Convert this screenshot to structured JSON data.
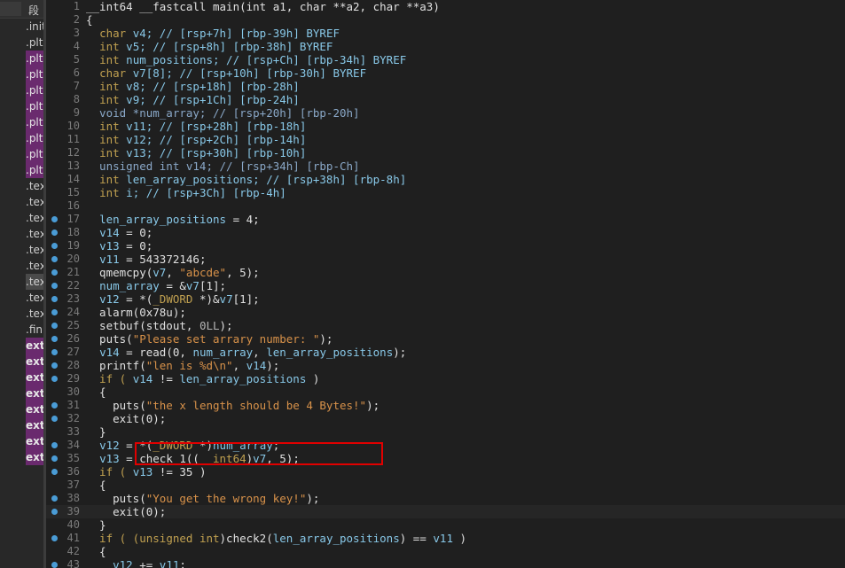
{
  "segments": {
    "header": "段",
    "rows": [
      {
        "label": ".init",
        "style": "plain"
      },
      {
        "label": ".plt",
        "style": "plain"
      },
      {
        "label": ".plt",
        "style": "purple"
      },
      {
        "label": ".plt",
        "style": "purple"
      },
      {
        "label": ".plt",
        "style": "purple"
      },
      {
        "label": ".plt",
        "style": "purple"
      },
      {
        "label": ".plt",
        "style": "purple"
      },
      {
        "label": ".plt",
        "style": "purple"
      },
      {
        "label": ".plt",
        "style": "purple"
      },
      {
        "label": ".plt",
        "style": "purple"
      },
      {
        "label": ".text",
        "style": "plain"
      },
      {
        "label": ".text",
        "style": "plain"
      },
      {
        "label": ".text",
        "style": "plain"
      },
      {
        "label": ".text",
        "style": "plain"
      },
      {
        "label": ".text",
        "style": "plain"
      },
      {
        "label": ".text",
        "style": "plain"
      },
      {
        "label": ".text",
        "style": "selected"
      },
      {
        "label": ".text",
        "style": "plain"
      },
      {
        "label": ".text",
        "style": "plain"
      },
      {
        "label": ".fini",
        "style": "plain"
      },
      {
        "label": "extern",
        "style": "ext"
      },
      {
        "label": "extern",
        "style": "ext"
      },
      {
        "label": "extern",
        "style": "ext"
      },
      {
        "label": "extern",
        "style": "ext"
      },
      {
        "label": "extern",
        "style": "ext"
      },
      {
        "label": "extern",
        "style": "ext"
      },
      {
        "label": "extern",
        "style": "ext"
      },
      {
        "label": "extern",
        "style": "ext"
      }
    ]
  },
  "code_lines": [
    {
      "num": "1",
      "dot": false,
      "tokens": [
        [
          "__int64 __fastcall main(int a1, char **a2, char **a3)",
          "df"
        ]
      ]
    },
    {
      "num": "2",
      "dot": false,
      "tokens": [
        [
          "{",
          "df"
        ]
      ]
    },
    {
      "num": "3",
      "dot": false,
      "tokens": [
        [
          "  ",
          "df"
        ],
        [
          "char",
          "kw"
        ],
        [
          " v4; // [rsp+7h] [rbp-39h] BYREF",
          "vr"
        ]
      ]
    },
    {
      "num": "4",
      "dot": false,
      "tokens": [
        [
          "  ",
          "df"
        ],
        [
          "int",
          "kw"
        ],
        [
          " v5; // [rsp+8h] [rbp-38h] BYREF",
          "vr"
        ]
      ]
    },
    {
      "num": "5",
      "dot": false,
      "tokens": [
        [
          "  ",
          "df"
        ],
        [
          "int",
          "kw"
        ],
        [
          " num_positions; // [rsp+Ch] [rbp-34h] BYREF",
          "vr"
        ]
      ]
    },
    {
      "num": "6",
      "dot": false,
      "tokens": [
        [
          "  ",
          "df"
        ],
        [
          "char",
          "kw"
        ],
        [
          " v7[8]; // [rsp+10h] [rbp-30h] BYREF",
          "vr"
        ]
      ]
    },
    {
      "num": "7",
      "dot": false,
      "tokens": [
        [
          "  ",
          "df"
        ],
        [
          "int",
          "kw"
        ],
        [
          " v8; // [rsp+18h] [rbp-28h]",
          "vr"
        ]
      ]
    },
    {
      "num": "8",
      "dot": false,
      "tokens": [
        [
          "  ",
          "df"
        ],
        [
          "int",
          "kw"
        ],
        [
          " v9; // [rsp+1Ch] [rbp-24h]",
          "vr"
        ]
      ]
    },
    {
      "num": "9",
      "dot": false,
      "tokens": [
        [
          "  void *num_array; // [rsp+20h] [rbp-20h]",
          "cm"
        ]
      ]
    },
    {
      "num": "10",
      "dot": false,
      "tokens": [
        [
          "  ",
          "df"
        ],
        [
          "int",
          "kw"
        ],
        [
          " v11; // [rsp+28h] [rbp-18h]",
          "vr"
        ]
      ]
    },
    {
      "num": "11",
      "dot": false,
      "tokens": [
        [
          "  ",
          "df"
        ],
        [
          "int",
          "kw"
        ],
        [
          " v12; // [rsp+2Ch] [rbp-14h]",
          "vr"
        ]
      ]
    },
    {
      "num": "12",
      "dot": false,
      "tokens": [
        [
          "  ",
          "df"
        ],
        [
          "int",
          "kw"
        ],
        [
          " v13; // [rsp+30h] [rbp-10h]",
          "vr"
        ]
      ]
    },
    {
      "num": "13",
      "dot": false,
      "tokens": [
        [
          "  unsigned int v14; // [rsp+34h] [rbp-Ch]",
          "cm"
        ]
      ]
    },
    {
      "num": "14",
      "dot": false,
      "tokens": [
        [
          "  ",
          "df"
        ],
        [
          "int",
          "kw"
        ],
        [
          " len_array_positions; // [rsp+38h] [rbp-8h]",
          "vr"
        ]
      ]
    },
    {
      "num": "15",
      "dot": false,
      "tokens": [
        [
          "  ",
          "df"
        ],
        [
          "int",
          "kw"
        ],
        [
          " i; // [rsp+3Ch] [rbp-4h]",
          "vr"
        ]
      ]
    },
    {
      "num": "16",
      "dot": false,
      "tokens": [
        [
          "",
          "df"
        ]
      ]
    },
    {
      "num": "17",
      "dot": true,
      "tokens": [
        [
          "  ",
          "df"
        ],
        [
          "len_array_positions",
          "vr"
        ],
        [
          " = 4;",
          "df"
        ]
      ]
    },
    {
      "num": "18",
      "dot": true,
      "tokens": [
        [
          "  ",
          "df"
        ],
        [
          "v14",
          "vr"
        ],
        [
          " = 0;",
          "df"
        ]
      ]
    },
    {
      "num": "19",
      "dot": true,
      "tokens": [
        [
          "  ",
          "df"
        ],
        [
          "v13",
          "vr"
        ],
        [
          " = 0;",
          "df"
        ]
      ]
    },
    {
      "num": "20",
      "dot": true,
      "tokens": [
        [
          "  ",
          "df"
        ],
        [
          "v11",
          "vr"
        ],
        [
          " = 543372146;",
          "df"
        ]
      ]
    },
    {
      "num": "21",
      "dot": true,
      "tokens": [
        [
          "  qmemcpy(",
          "df"
        ],
        [
          "v7",
          "vr"
        ],
        [
          ", ",
          "df"
        ],
        [
          "\"abcde\"",
          "st"
        ],
        [
          ", 5);",
          "df"
        ]
      ]
    },
    {
      "num": "22",
      "dot": true,
      "tokens": [
        [
          "  ",
          "df"
        ],
        [
          "num_array",
          "vr"
        ],
        [
          " = &",
          "df"
        ],
        [
          "v7",
          "vr"
        ],
        [
          "[1];",
          "df"
        ]
      ]
    },
    {
      "num": "23",
      "dot": true,
      "tokens": [
        [
          "  ",
          "df"
        ],
        [
          "v12",
          "vr"
        ],
        [
          " = *(",
          "df"
        ],
        [
          "_DWORD",
          "kw"
        ],
        [
          " *)&",
          "df"
        ],
        [
          "v7",
          "vr"
        ],
        [
          "[1];",
          "df"
        ]
      ]
    },
    {
      "num": "24",
      "dot": true,
      "tokens": [
        [
          "  alarm(0x78u);",
          "df"
        ]
      ]
    },
    {
      "num": "25",
      "dot": true,
      "tokens": [
        [
          "  setbuf(stdout, ",
          "df"
        ],
        [
          "0LL",
          "nm"
        ],
        [
          ");",
          "df"
        ]
      ]
    },
    {
      "num": "26",
      "dot": true,
      "tokens": [
        [
          "  puts(",
          "df"
        ],
        [
          "\"Please set arrary number: \"",
          "st"
        ],
        [
          ");",
          "df"
        ]
      ]
    },
    {
      "num": "27",
      "dot": true,
      "tokens": [
        [
          "  ",
          "df"
        ],
        [
          "v14",
          "vr"
        ],
        [
          " = read(0, ",
          "df"
        ],
        [
          "num_array",
          "vr"
        ],
        [
          ", ",
          "df"
        ],
        [
          "len_array_positions",
          "vr"
        ],
        [
          ");",
          "df"
        ]
      ]
    },
    {
      "num": "28",
      "dot": true,
      "tokens": [
        [
          "  printf(",
          "df"
        ],
        [
          "\"len is %d\\n\"",
          "st"
        ],
        [
          ", ",
          "df"
        ],
        [
          "v14",
          "vr"
        ],
        [
          ");",
          "df"
        ]
      ]
    },
    {
      "num": "29",
      "dot": true,
      "tokens": [
        [
          "  if ( ",
          "kw"
        ],
        [
          "v14",
          "vr"
        ],
        [
          " != ",
          "df"
        ],
        [
          "len_array_positions",
          "vr"
        ],
        [
          " )",
          "df"
        ]
      ]
    },
    {
      "num": "30",
      "dot": false,
      "tokens": [
        [
          "  {",
          "df"
        ]
      ]
    },
    {
      "num": "31",
      "dot": true,
      "tokens": [
        [
          "    puts(",
          "df"
        ],
        [
          "\"the x length should be 4 Bytes!\"",
          "st"
        ],
        [
          ");",
          "df"
        ]
      ]
    },
    {
      "num": "32",
      "dot": true,
      "tokens": [
        [
          "    exit(0);",
          "df"
        ]
      ]
    },
    {
      "num": "33",
      "dot": false,
      "tokens": [
        [
          "  }",
          "df"
        ]
      ]
    },
    {
      "num": "34",
      "dot": true,
      "tokens": [
        [
          "  ",
          "df"
        ],
        [
          "v12",
          "vr"
        ],
        [
          " = *(",
          "df"
        ],
        [
          "_DWORD",
          "kw"
        ],
        [
          " *)",
          "df"
        ],
        [
          "num_array",
          "vr"
        ],
        [
          ";",
          "df"
        ]
      ]
    },
    {
      "num": "35",
      "dot": true,
      "tokens": [
        [
          "  ",
          "df"
        ],
        [
          "v13",
          "vr"
        ],
        [
          " = check_1((",
          "df"
        ],
        [
          "__int64",
          "kw"
        ],
        [
          ")",
          "df"
        ],
        [
          "v7",
          "vr"
        ],
        [
          ", 5);",
          "df"
        ]
      ]
    },
    {
      "num": "36",
      "dot": true,
      "tokens": [
        [
          "  if ( ",
          "kw"
        ],
        [
          "v13",
          "vr"
        ],
        [
          " != 35 )",
          "df"
        ]
      ]
    },
    {
      "num": "37",
      "dot": false,
      "tokens": [
        [
          "  {",
          "df"
        ]
      ]
    },
    {
      "num": "38",
      "dot": true,
      "tokens": [
        [
          "    puts(",
          "df"
        ],
        [
          "\"You get the wrong key!\"",
          "st"
        ],
        [
          ");",
          "df"
        ]
      ]
    },
    {
      "num": "39",
      "dot": true,
      "tokens": [
        [
          "    exit(0);",
          "df"
        ]
      ],
      "hl": true
    },
    {
      "num": "40",
      "dot": false,
      "tokens": [
        [
          "  }",
          "df"
        ]
      ]
    },
    {
      "num": "41",
      "dot": true,
      "tokens": [
        [
          "  if ( (",
          "kw"
        ],
        [
          "unsigned int",
          "kw"
        ],
        [
          ")check2(",
          "df"
        ],
        [
          "len_array_positions",
          "vr"
        ],
        [
          ") == ",
          "df"
        ],
        [
          "v11",
          "vr"
        ],
        [
          " )",
          "df"
        ]
      ]
    },
    {
      "num": "42",
      "dot": false,
      "tokens": [
        [
          "  {",
          "df"
        ]
      ]
    },
    {
      "num": "43",
      "dot": true,
      "tokens": [
        [
          "    ",
          "df"
        ],
        [
          "v12",
          "vr"
        ],
        [
          " += ",
          "df"
        ],
        [
          "v11",
          "vr"
        ],
        [
          ";",
          "df"
        ]
      ]
    }
  ]
}
